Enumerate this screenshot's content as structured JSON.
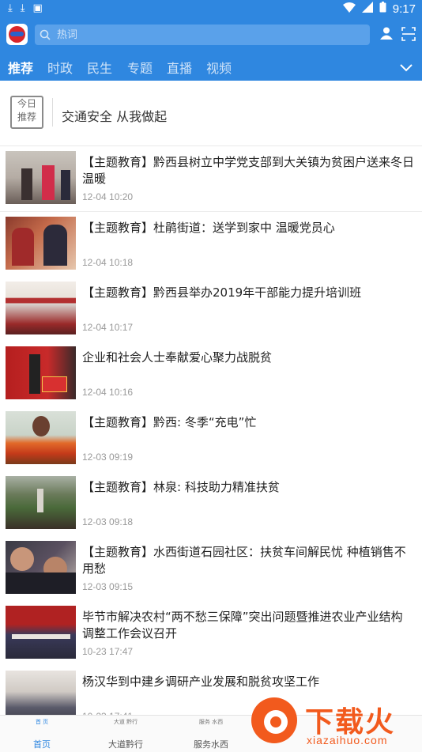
{
  "status": {
    "time": "9:17"
  },
  "appbar": {
    "search_placeholder": "热词"
  },
  "tabs": [
    {
      "label": "推荐"
    },
    {
      "label": "时政"
    },
    {
      "label": "民生"
    },
    {
      "label": "专题"
    },
    {
      "label": "直播"
    },
    {
      "label": "视频"
    }
  ],
  "today": {
    "badge_line1": "今日",
    "badge_line2": "推荐",
    "headline": "交通安全 从我做起"
  },
  "news": [
    {
      "title": "【主题教育】黔西县树立中学党支部到大关镇为贫困户送来冬日温暖",
      "time": "12-04 10:20"
    },
    {
      "title": "【主题教育】杜鹃街道：送学到家中 温暖党员心",
      "time": "12-04 10:18"
    },
    {
      "title": "【主题教育】黔西县举办2019年干部能力提升培训班",
      "time": "12-04 10:17"
    },
    {
      "title": "企业和社会人士奉献爱心聚力战脱贫",
      "time": "12-04 10:16"
    },
    {
      "title": "【主题教育】黔西: 冬季“充电”忙",
      "time": "12-03 09:19"
    },
    {
      "title": "【主题教育】林泉: 科技助力精准扶贫",
      "time": "12-03 09:18"
    },
    {
      "title": "【主题教育】水西街道石园社区：扶贫车间解民忧 种植销售不用愁",
      "time": "12-03 09:15"
    },
    {
      "title": "毕节市解决农村“两不愁三保障”突出问题暨推进农业产业结构调整工作会议召开",
      "time": "10-23 17:47"
    },
    {
      "title": "杨汉华到中建乡调研产业发展和脱贫攻坚工作",
      "time": "10-23 17:41"
    }
  ],
  "bottomnav": [
    {
      "mini": "首 页",
      "label": "首页"
    },
    {
      "mini": "大道 黔行",
      "label": "大道黔行"
    },
    {
      "mini": "服务 水西",
      "label": "服务水西"
    }
  ],
  "watermark": {
    "brand": "下载火",
    "domain": "xiazaihuo.com"
  },
  "colors": {
    "primary": "#2f87e0",
    "watermark": "#f25a1d"
  }
}
